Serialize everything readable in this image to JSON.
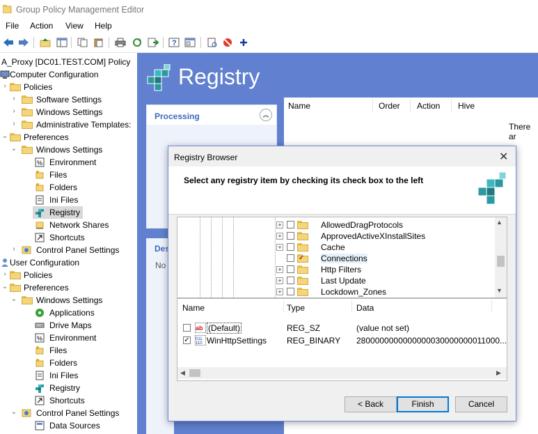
{
  "window": {
    "title": "Group Policy Management Editor"
  },
  "menu": [
    "File",
    "Action",
    "View",
    "Help"
  ],
  "toolbar_icons": [
    "back-arrow-icon",
    "forward-arrow-icon",
    "up-folder-icon",
    "show-tree-icon",
    "copy-icon",
    "paste-icon",
    "print-icon",
    "refresh-icon",
    "export-icon",
    "help-icon",
    "properties-icon",
    "new-doc-icon",
    "stop-icon",
    "add-icon"
  ],
  "tree": {
    "root": "A_Proxy [DC01.TEST.COM] Policy",
    "items": [
      {
        "label": "Computer Configuration"
      },
      {
        "label": "Policies"
      },
      {
        "label": "Software Settings"
      },
      {
        "label": "Windows Settings"
      },
      {
        "label": "Administrative Templates:"
      },
      {
        "label": "Preferences"
      },
      {
        "label": "Windows Settings"
      },
      {
        "label": "Environment"
      },
      {
        "label": "Files"
      },
      {
        "label": "Folders"
      },
      {
        "label": "Ini Files"
      },
      {
        "label": "Registry"
      },
      {
        "label": "Network Shares"
      },
      {
        "label": "Shortcuts"
      },
      {
        "label": "Control Panel Settings"
      },
      {
        "label": "User Configuration"
      },
      {
        "label": "Policies"
      },
      {
        "label": "Preferences"
      },
      {
        "label": "Windows Settings"
      },
      {
        "label": "Applications"
      },
      {
        "label": "Drive Maps"
      },
      {
        "label": "Environment"
      },
      {
        "label": "Files"
      },
      {
        "label": "Folders"
      },
      {
        "label": "Ini Files"
      },
      {
        "label": "Registry"
      },
      {
        "label": "Shortcuts"
      },
      {
        "label": "Control Panel Settings"
      },
      {
        "label": "Data Sources"
      }
    ]
  },
  "right": {
    "title": "Registry",
    "processing": "Processing",
    "desc_header": "Des",
    "desc_text": "No",
    "columns": [
      "Name",
      "Order",
      "Action",
      "Hive"
    ],
    "empty_text": "There ar"
  },
  "dialog": {
    "title": "Registry Browser",
    "close": "✕",
    "instruction": "Select any registry item by checking its check box to the left",
    "keys": [
      "AllowedDragProtocols",
      "ApprovedActiveXInstallSites",
      "Cache",
      "Connections",
      "Http Filters",
      "Last Update",
      "Lockdown_Zones"
    ],
    "value_columns": [
      "Name",
      "Type",
      "Data"
    ],
    "values": [
      {
        "name": "(Default)",
        "type": "REG_SZ",
        "data": "(value not set)",
        "checked": false
      },
      {
        "name": "WinHttpSettings",
        "type": "REG_BINARY",
        "data": "2800000000000000030000000011000...",
        "checked": true
      }
    ],
    "buttons": {
      "back": "< Back",
      "finish": "Finish",
      "cancel": "Cancel"
    }
  }
}
